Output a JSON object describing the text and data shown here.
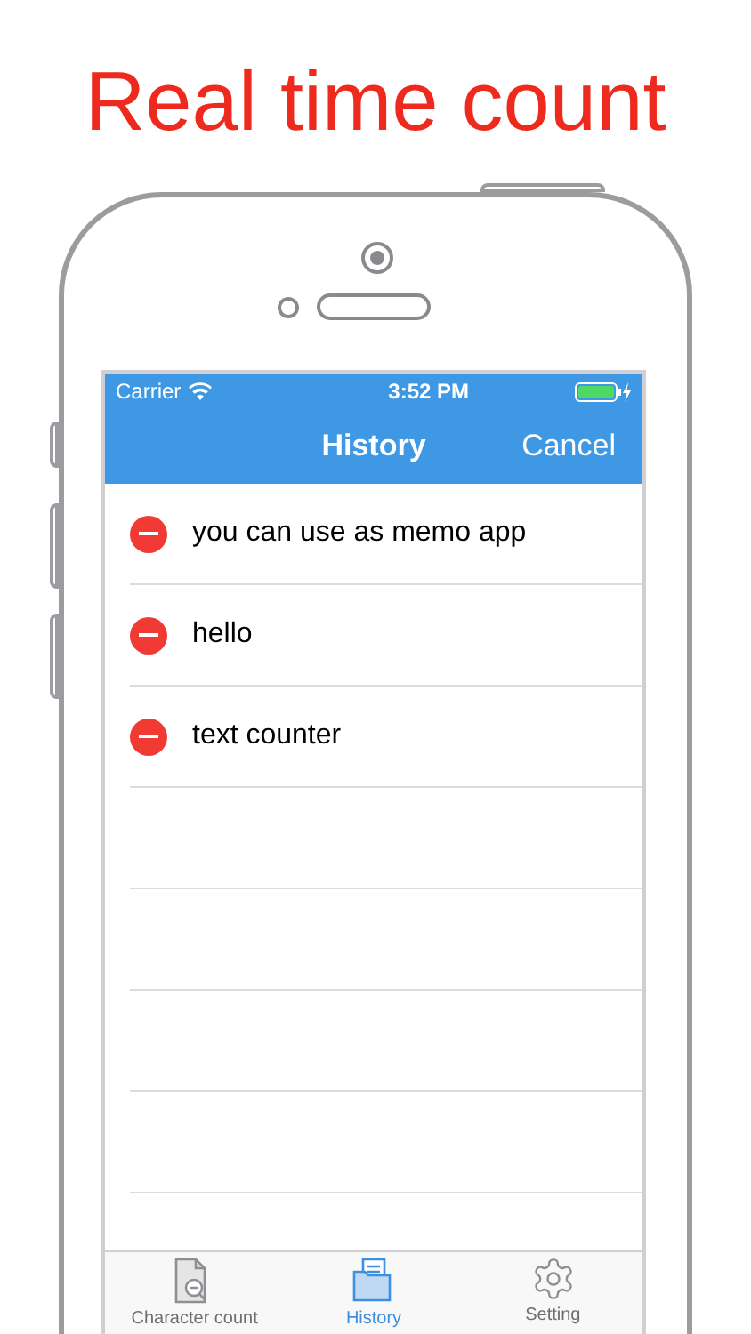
{
  "headline": "Real time count",
  "status_bar": {
    "carrier": "Carrier",
    "time": "3:52 PM"
  },
  "nav": {
    "title": "History",
    "cancel": "Cancel"
  },
  "items": [
    {
      "text": "you can use as memo app"
    },
    {
      "text": "hello"
    },
    {
      "text": "text counter"
    }
  ],
  "tabs": [
    {
      "label": "Character count",
      "selected": false,
      "kind": "document"
    },
    {
      "label": "History",
      "selected": true,
      "kind": "folder"
    },
    {
      "label": "Setting",
      "selected": false,
      "kind": "gear"
    }
  ]
}
